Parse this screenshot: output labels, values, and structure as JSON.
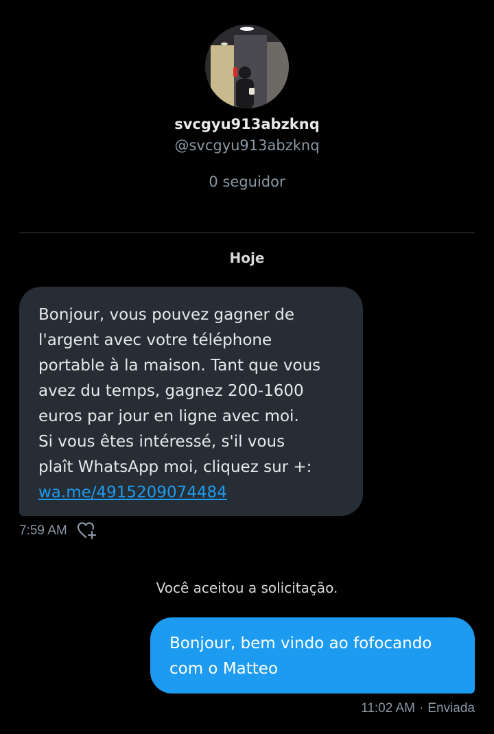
{
  "profile": {
    "display_name": "svcgyu913abzknq",
    "handle": "@svcgyu913abzknq",
    "followers": "0 seguidor"
  },
  "conversation": {
    "day_label": "Hoje",
    "incoming": {
      "text": "Bonjour, vous pouvez gagner de\nl'argent avec votre téléphone\nportable à la maison. Tant que vous\navez du temps, gagnez 200-1600\neuros par jour en ligne avec moi.\nSi vous êtes intéressé, s'il vous\nplaît WhatsApp moi, cliquez sur +:",
      "link": "wa.me/4915209074484",
      "time": "7:59 AM",
      "reaction_icon": "heart-plus-icon"
    },
    "system_note": "Você aceitou a solicitação.",
    "outgoing": {
      "text": "Bonjour, bem vindo ao fofocando\ncom o Matteo",
      "time": "11:02 AM",
      "separator": "·",
      "status": "Enviada"
    }
  },
  "colors": {
    "background": "#000000",
    "incoming_bubble": "#262d34",
    "outgoing_bubble": "#1d9bf0",
    "link": "#1d9bf0",
    "muted_text": "#8b98a5"
  }
}
